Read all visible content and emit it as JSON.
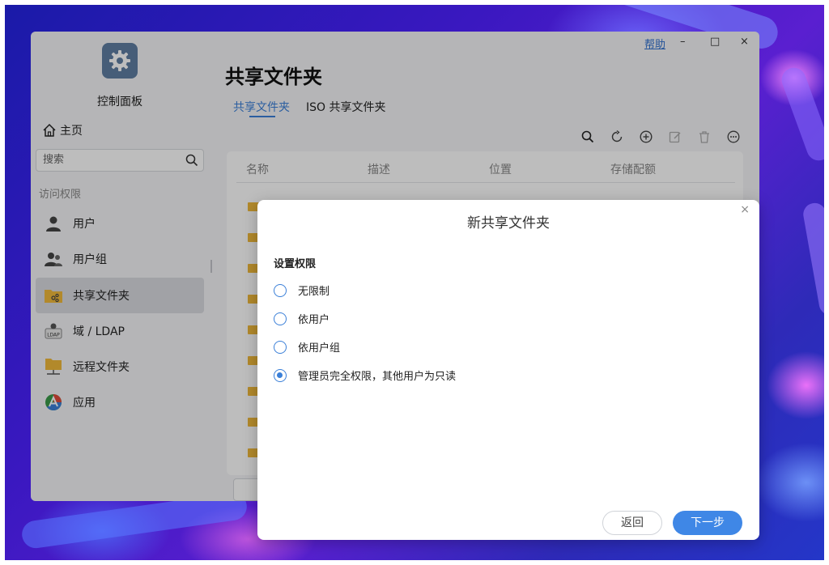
{
  "window": {
    "help_label": "帮助",
    "minimize_glyph": "–",
    "maximize_glyph": "□",
    "close_glyph": "×"
  },
  "sidebar": {
    "app_title": "控制面板",
    "home_label": "主页",
    "search_placeholder": "搜索",
    "section_label": "访问权限",
    "items": [
      {
        "label": "用户",
        "icon": "user-icon"
      },
      {
        "label": "用户组",
        "icon": "user-group-icon"
      },
      {
        "label": "共享文件夹",
        "icon": "shared-folder-icon",
        "active": true
      },
      {
        "label": "域 / LDAP",
        "icon": "ldap-icon",
        "badge": "LDAP"
      },
      {
        "label": "远程文件夹",
        "icon": "remote-folder-icon"
      },
      {
        "label": "应用",
        "icon": "app-icon"
      }
    ]
  },
  "main": {
    "title": "共享文件夹",
    "tabs": [
      {
        "label": "共享文件夹",
        "active": true
      },
      {
        "label": "ISO 共享文件夹",
        "active": false
      }
    ],
    "table_headers": [
      "名称",
      "描述",
      "位置",
      "存储配额"
    ]
  },
  "dialog": {
    "title": "新共享文件夹",
    "close_glyph": "×",
    "section_title": "设置权限",
    "options": [
      {
        "label": "无限制",
        "checked": false
      },
      {
        "label": "依用户",
        "checked": false
      },
      {
        "label": "依用户组",
        "checked": false
      },
      {
        "label": "管理员完全权限，其他用户为只读",
        "checked": true
      }
    ],
    "back_label": "返回",
    "next_label": "下一步"
  },
  "colors": {
    "accent": "#3a7fd8",
    "primary_button": "#3f87e6",
    "folder": "#f0b93a"
  }
}
